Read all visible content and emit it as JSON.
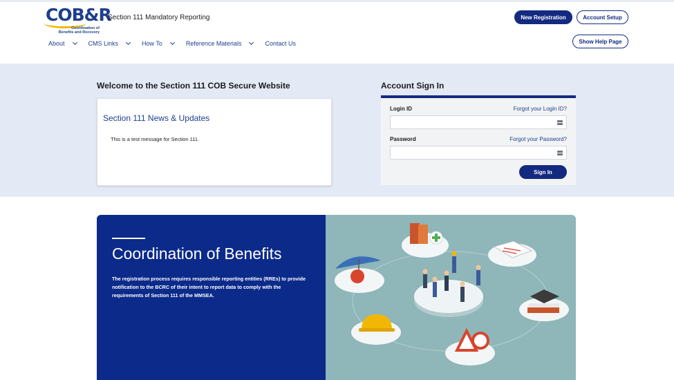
{
  "header": {
    "logo_text": "COB&R",
    "logo_subtitle": "Coordination of Benefits and Recovery",
    "site_title": "Section 111 Mandatory Reporting",
    "new_registration": "New Registration",
    "account_setup": "Account Setup",
    "show_help": "Show Help Page"
  },
  "nav": [
    {
      "label": "About",
      "has_dropdown": true
    },
    {
      "label": "CMS Links",
      "has_dropdown": true
    },
    {
      "label": "How To",
      "has_dropdown": true
    },
    {
      "label": "Reference Materials",
      "has_dropdown": true
    },
    {
      "label": "Contact Us",
      "has_dropdown": false
    }
  ],
  "welcome": {
    "title": "Welcome to the Section 111 COB Secure Website",
    "news_title": "Section 111 News & Updates",
    "news_body": "This is a test message for Section 111."
  },
  "signin": {
    "title": "Account Sign In",
    "login_label": "Login ID",
    "login_forgot": "Forgot your Login ID?",
    "login_value": "",
    "password_label": "Password",
    "password_forgot": "Forgot your Password?",
    "password_value": "",
    "button": "Sign In"
  },
  "banner": {
    "heading": "Coordination of Benefits",
    "body": "The registration process requires responsible reporting entities (RREs) to provide notification to the BCRC of their intent to report data to comply with the requirements of Section 111 of the MMSEA."
  },
  "colors": {
    "primary": "#132a80",
    "banner_blue": "#0b2a8a",
    "band_bg": "#e3eaf6",
    "teal": "#8fb6b9",
    "logo_yellow": "#f2b705"
  }
}
